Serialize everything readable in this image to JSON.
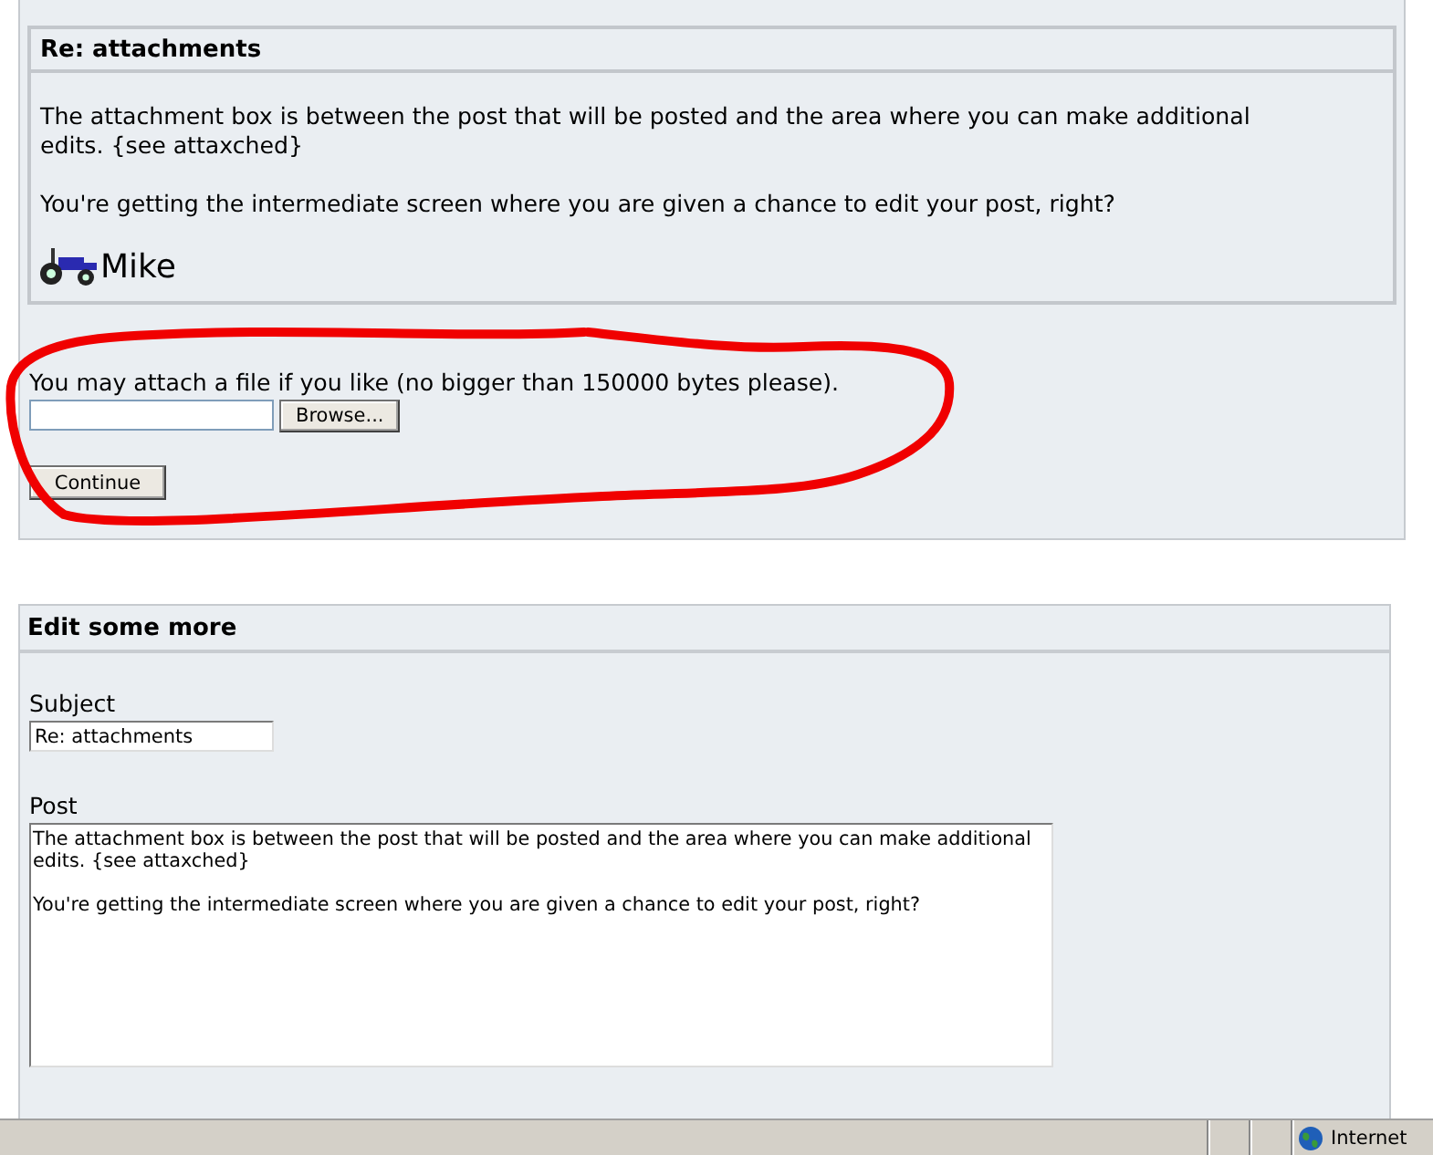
{
  "post": {
    "title": "Re: attachments",
    "paragraphs": [
      "The attachment box is between the post that will be posted and the area where you can make additional edits. {see attaxched}",
      "You're getting the intermediate screen where you are given a chance to edit your post, right?"
    ],
    "signature": "Mike"
  },
  "attach": {
    "prompt": "You may attach a file if you like (no bigger than 150000 bytes please).",
    "browse_button": "Browse...",
    "continue_button": "Continue"
  },
  "edit": {
    "title": "Edit some more",
    "subject": {
      "label": "Subject",
      "value": "Re: attachments"
    },
    "post": {
      "label": "Post",
      "value": "The attachment box is between the post that will be posted and the area where you can make additional edits. {see attaxched}\n\nYou're getting the intermediate screen where you are given a chance to edit your post, right?"
    }
  },
  "status_bar": {
    "zone": "Internet"
  }
}
